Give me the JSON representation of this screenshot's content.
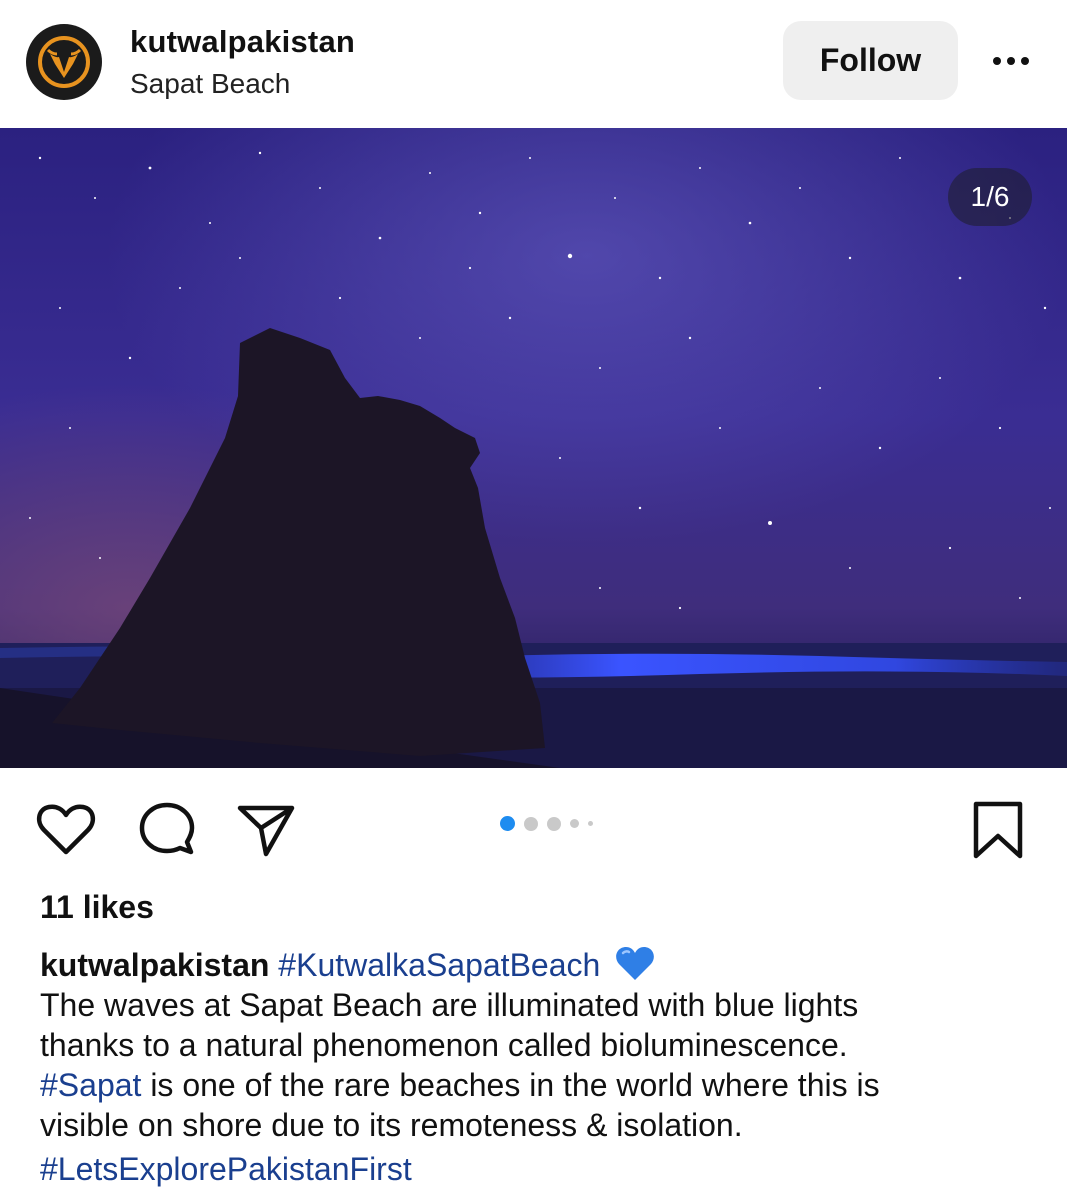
{
  "post": {
    "username": "kutwalpakistan",
    "location": "Sapat Beach",
    "follow_label": "Follow",
    "image_counter": "1/6",
    "likes": "11 likes",
    "carousel": {
      "total_dots": 5,
      "active_index": 0
    },
    "caption": {
      "username": "kutwalpakistan",
      "hashtag_1": "#KutwalkaSapatBeach",
      "emoji": "blue-heart",
      "line_1": "The waves at Sapat Beach are illuminated with blue lights",
      "line_2": "thanks to a natural phenomenon called bioluminescence.",
      "hashtag_2": "#Sapat",
      "line_3": " is one of the rare beaches in the world where this is",
      "line_4": "visible on shore due to its remoteness & isolation.",
      "hashtag_3": "#LetsExplorePakistanFirst"
    }
  },
  "icons": {
    "avatar": "ox-head-logo",
    "more": "ellipsis-icon",
    "like": "heart-icon",
    "comment": "comment-bubble-icon",
    "share": "send-icon",
    "save": "bookmark-icon"
  },
  "colors": {
    "hashtag": "#1a3f8f",
    "active_dot": "#1e8cf0",
    "follow_bg": "#efefef",
    "logo_orange": "#e8931f"
  }
}
